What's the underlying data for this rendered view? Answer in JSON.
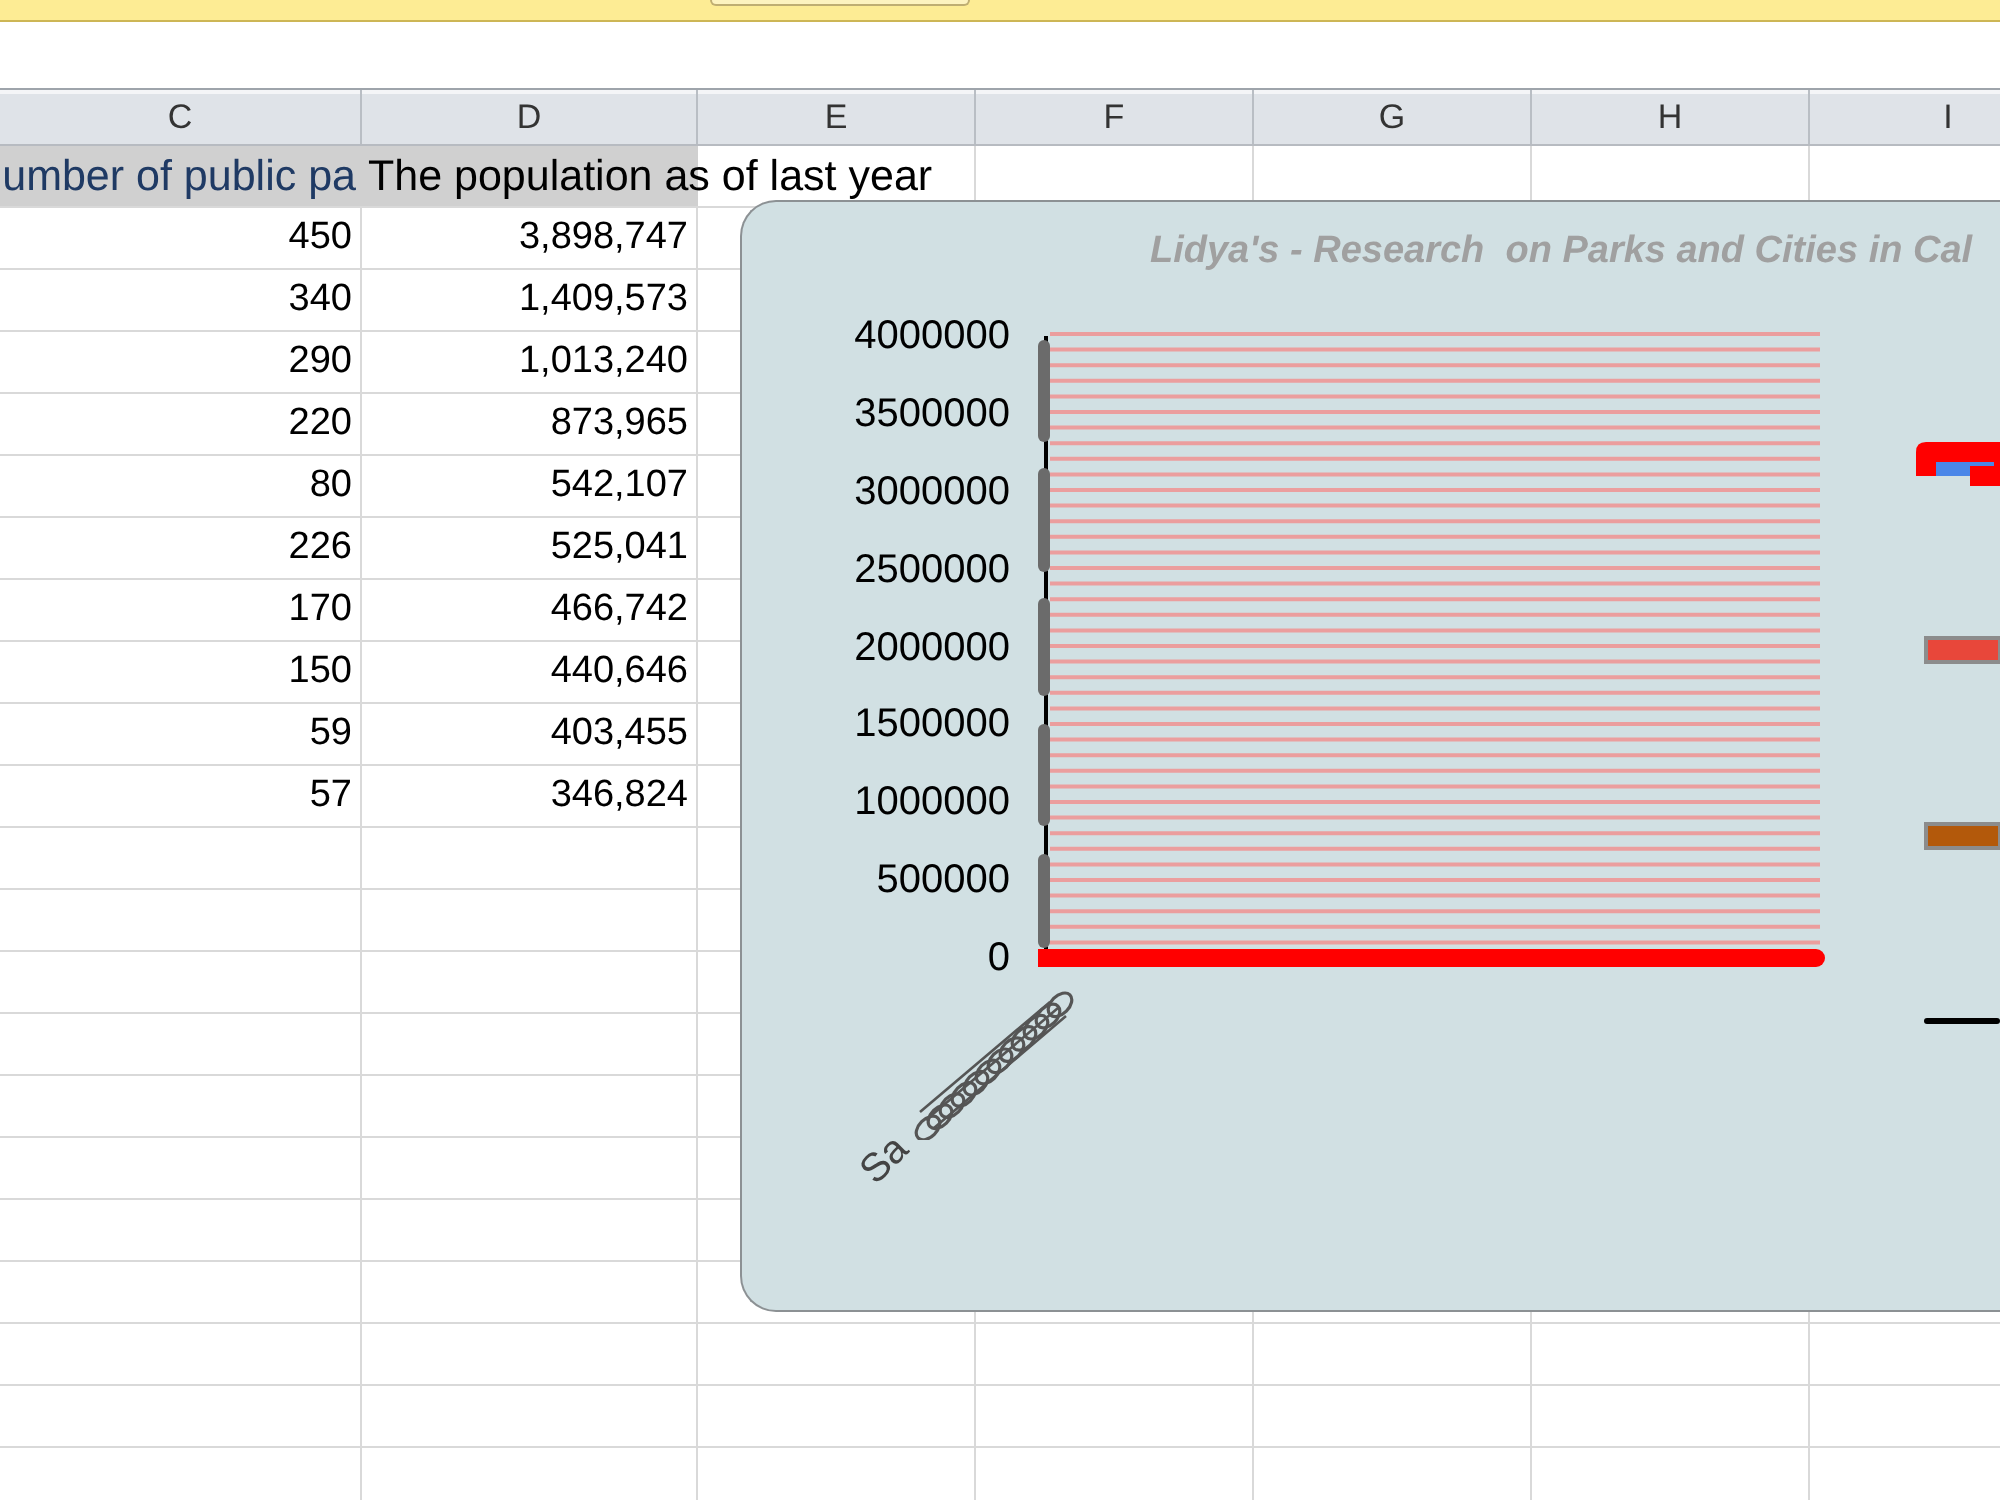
{
  "sheet": {
    "columns": [
      "C",
      "D",
      "E",
      "F",
      "G",
      "H",
      "I"
    ],
    "header_cells": [
      {
        "text": "umber of public pa",
        "color": "#1f3a64"
      },
      {
        "text": "The population as of last year",
        "color": "#000000"
      }
    ],
    "rows": [
      [
        "450",
        "3,898,747"
      ],
      [
        "340",
        "1,409,573"
      ],
      [
        "290",
        "1,013,240"
      ],
      [
        "220",
        "873,965"
      ],
      [
        "80",
        "542,107"
      ],
      [
        "226",
        "525,041"
      ],
      [
        "170",
        "466,742"
      ],
      [
        "150",
        "440,646"
      ],
      [
        "59",
        "403,455"
      ],
      [
        "57",
        "346,824"
      ]
    ]
  },
  "chart": {
    "title": "Lidya's - Research  on Parks and Cities in Cal",
    "y_axis_labels": [
      "4000000",
      "3500000",
      "3000000",
      "2500000",
      "2000000",
      "1500000",
      "1000000",
      "500000",
      "0"
    ],
    "x_axis_label_fragment": "Sa",
    "legend": [
      {
        "kind": "combo",
        "color": "#ff0000"
      },
      {
        "kind": "swatch",
        "color": "#e8473a"
      },
      {
        "kind": "swatch",
        "color": "#b3590b"
      },
      {
        "kind": "line",
        "color": "#000000"
      }
    ]
  }
}
